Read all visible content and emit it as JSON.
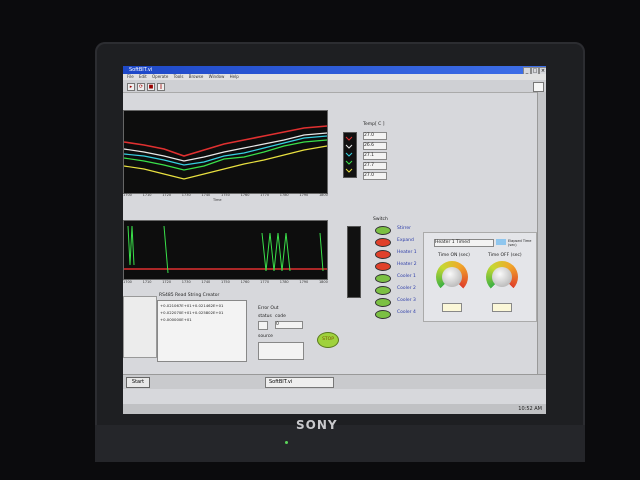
{
  "window": {
    "title": "SoftBIT.vi"
  },
  "menu": [
    "File",
    "Edit",
    "Operate",
    "Tools",
    "Browse",
    "Window",
    "Help"
  ],
  "temp_panel": {
    "label": "Temp[ C ]",
    "values": [
      "27.0",
      "26.6",
      "27.1",
      "27.7",
      "27.0"
    ]
  },
  "chart_top": {
    "xlabel": "Time",
    "ticks": [
      "1700",
      "1705",
      "1710",
      "1715",
      "1720",
      "1725",
      "1730",
      "1735",
      "1740",
      "1745",
      "1750",
      "1755",
      "1760",
      "1765",
      "1770",
      "1775",
      "1780",
      "1785",
      "1790",
      "1795",
      "1800"
    ]
  },
  "chart_bottom": {
    "ticks": [
      "1700",
      "1705",
      "1710",
      "1715",
      "1720",
      "1725",
      "1730",
      "1735",
      "1740",
      "1745",
      "1750",
      "1755",
      "1760",
      "1765",
      "1770",
      "1775",
      "1780",
      "1785",
      "1790",
      "1795",
      "1800"
    ]
  },
  "switch_panel": {
    "label": "Switch",
    "items": [
      {
        "label": "Stirrer",
        "color": "#7bc043"
      },
      {
        "label": "Expand",
        "color": "#e0402a"
      },
      {
        "label": "Heater 1",
        "color": "#e0402a"
      },
      {
        "label": "Heater 2",
        "color": "#e0402a"
      },
      {
        "label": "Cooler 1",
        "color": "#7bc043"
      },
      {
        "label": "Cooler 2",
        "color": "#7bc043"
      },
      {
        "label": "Cooler 3",
        "color": "#7bc043"
      },
      {
        "label": "Cooler 4",
        "color": "#7bc043"
      }
    ]
  },
  "timer_panel": {
    "select_value": "Heater 1 Timed",
    "elapsed_label": "Elapsed Time (sec)",
    "dial1_label": "Time ON (sec)",
    "dial2_label": "Time OFF (sec)"
  },
  "serial_box": {
    "label": "RS485 Read String Creator",
    "lines": [
      "+0.021067E+01+0.021462E+01",
      "+0.022070E+01+0.025802E+01",
      "+0.000000E+01"
    ]
  },
  "error_box": {
    "label": "Error Out",
    "status_label": "status",
    "code_label": "code",
    "code_value": "0",
    "source_label": "source"
  },
  "stop_button": {
    "label": "STOP"
  },
  "taskbar": {
    "start": "Start",
    "task": "SoftBIT.vi",
    "clock": "10:52 AM"
  },
  "brand": "SONY",
  "colors": {
    "titlebar": "#2a55d6",
    "plot_bg": "#0d0d0d",
    "stop_button": "#9fd23c"
  }
}
